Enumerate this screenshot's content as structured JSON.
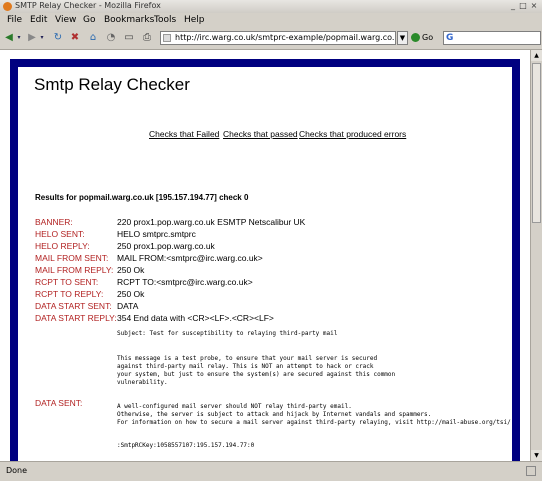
{
  "window": {
    "title": "SMTP Relay Checker - Mozilla Firefox",
    "controls": [
      "_",
      "□",
      "×"
    ]
  },
  "menu": [
    "File",
    "Edit",
    "View",
    "Go",
    "Bookmarks",
    "Tools",
    "Help"
  ],
  "toolbar": {
    "url": "http://irc.warg.co.uk/smtprc-example/popmail.warg.co.uk.html",
    "go_label": "Go"
  },
  "page": {
    "title": "Smtp Relay Checker",
    "nav": [
      "Checks that Failed",
      "Checks that passed",
      "Checks that produced errors"
    ],
    "results_heading": "Results for popmail.warg.co.uk [195.157.194.77] check 0",
    "rows": [
      {
        "label": "BANNER:",
        "value": "220 prox1.pop.warg.co.uk ESMTP Netscalibur UK"
      },
      {
        "label": "HELO SENT:",
        "value": "HELO smtprc.smtprc"
      },
      {
        "label": "HELO REPLY:",
        "value": "250 prox1.pop.warg.co.uk"
      },
      {
        "label": "MAIL FROM SENT:",
        "value": "MAIL FROM:<smtprc@irc.warg.co.uk>"
      },
      {
        "label": "MAIL FROM REPLY:",
        "value": "250 Ok"
      },
      {
        "label": "RCPT TO SENT:",
        "value": "RCPT TO:<smtprc@irc.warg.co.uk>"
      },
      {
        "label": "RCPT TO REPLY:",
        "value": "250 Ok"
      },
      {
        "label": "DATA START SENT:",
        "value": "DATA"
      },
      {
        "label": "DATA START REPLY:",
        "value": "354 End data with <CR><LF>.<CR><LF>"
      }
    ],
    "data_sent_label": "DATA SENT:",
    "mono_subject": "Subject: Test for susceptibility to relaying third-party mail",
    "mono_body1": "This message is a test probe, to ensure that your mail server is secured\nagainst third-party mail relay. This is NOT an attempt to hack or crack\nyour system, but just to ensure the system(s) are secured against this common\nvulnerability.",
    "mono_body2": "A well-configured mail server should NOT relay third-party email.\nOtherwise, the server is subject to attack and hijack by Internet vandals and spammers.\nFor information on how to secure a mail server against third-party relaying, visit http://mail-abuse.org/tsi/",
    "mono_key": ":SmtpRCKey:1058557107:195.157.194.77:0",
    "mono_dot": "."
  },
  "status": {
    "text": "Done"
  }
}
